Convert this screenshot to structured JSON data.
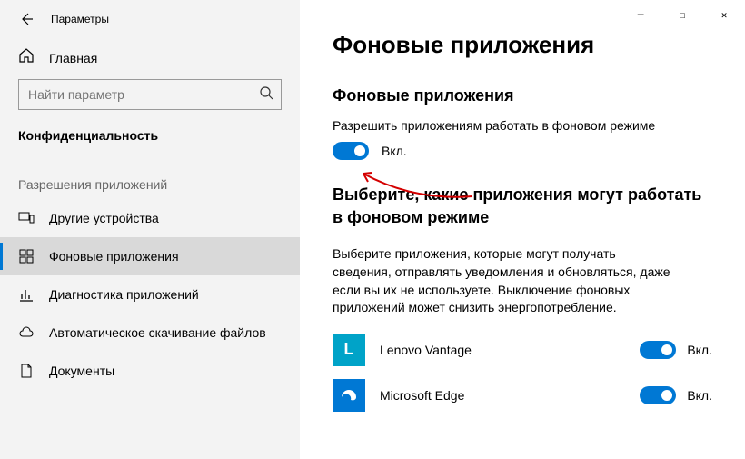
{
  "titlebar": {
    "title": "Параметры"
  },
  "sidebar": {
    "home": "Главная",
    "search_placeholder": "Найти параметр",
    "section": "Конфиденциальность",
    "group": "Разрешения приложений",
    "items": [
      {
        "label": "Другие устройства"
      },
      {
        "label": "Фоновые приложения"
      },
      {
        "label": "Диагностика приложений"
      },
      {
        "label": "Автоматическое скачивание файлов"
      },
      {
        "label": "Документы"
      }
    ]
  },
  "main": {
    "heading": "Фоновые приложения",
    "sub1": "Фоновые приложения",
    "desc1": "Разрешить приложениям работать в фоновом режиме",
    "master_toggle": "Вкл.",
    "sub2": "Выберите, какие приложения могут работать в фоновом режиме",
    "para": "Выберите приложения, которые могут получать сведения, отправлять уведомления и обновляться, даже если вы их не используете. Выключение фоновых приложений может снизить энергопотребление.",
    "apps": [
      {
        "name": "Lenovo Vantage",
        "state": "Вкл."
      },
      {
        "name": "Microsoft Edge",
        "state": "Вкл."
      }
    ]
  }
}
